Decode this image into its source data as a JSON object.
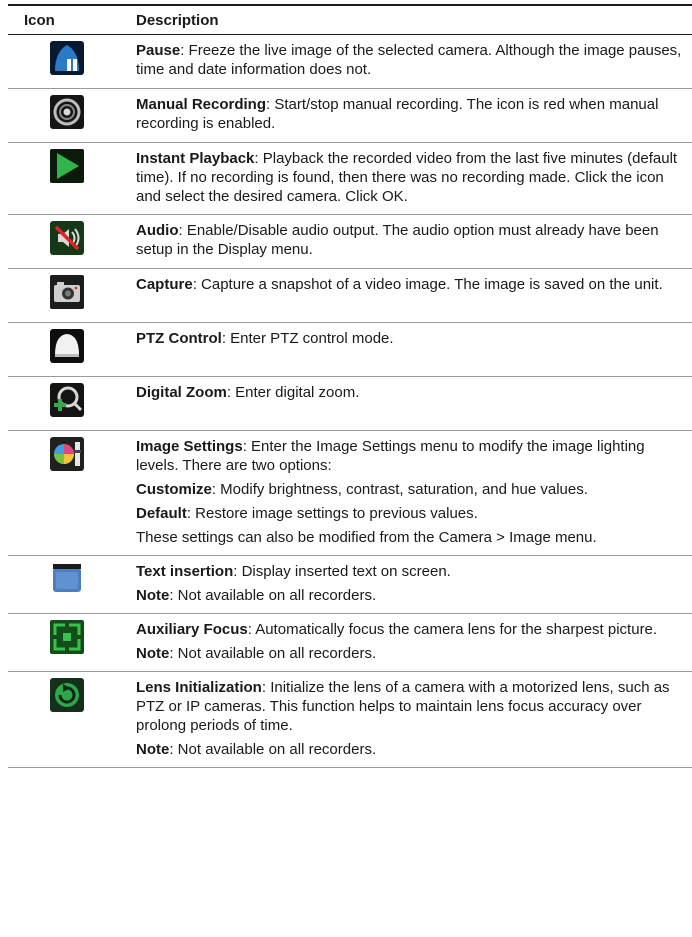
{
  "header": {
    "col_icon": "Icon",
    "col_desc": "Description"
  },
  "rows": [
    {
      "icon": "pause-icon",
      "paras": [
        {
          "term": "Pause",
          "text": ": Freeze the live image of the selected camera. Although the image pauses, time and date information does not."
        }
      ]
    },
    {
      "icon": "manual-record-icon",
      "paras": [
        {
          "term": "Manual Recording",
          "text": ": Start/stop manual recording. The icon is red when manual recording is enabled."
        }
      ]
    },
    {
      "icon": "instant-playback-icon",
      "paras": [
        {
          "term": "Instant Playback",
          "text": ": Playback the recorded video from the last five minutes (default time). If no recording is found, then there was no recording made. Click the icon and select the desired camera. Click OK."
        }
      ]
    },
    {
      "icon": "audio-mute-icon",
      "paras": [
        {
          "term": "Audio",
          "text": ": Enable/Disable audio output. The audio option must already have been setup in the Display menu."
        }
      ]
    },
    {
      "icon": "capture-camera-icon",
      "paras": [
        {
          "term": "Capture",
          "text": ": Capture a snapshot of a video image. The image is saved on the unit."
        }
      ]
    },
    {
      "icon": "ptz-dome-icon",
      "paras": [
        {
          "term": "PTZ Control",
          "text": ": Enter PTZ control mode."
        }
      ]
    },
    {
      "icon": "digital-zoom-icon",
      "paras": [
        {
          "term": "Digital Zoom",
          "text": ": Enter digital zoom."
        }
      ]
    },
    {
      "icon": "image-settings-icon",
      "paras": [
        {
          "term": "Image Settings",
          "text": ": Enter the Image Settings menu to modify the image lighting levels. There are two options:"
        },
        {
          "term": "Customize",
          "text": ": Modify brightness, contrast, saturation, and hue values."
        },
        {
          "term": "Default",
          "text": ": Restore image settings to previous values."
        },
        {
          "term": "",
          "text": "These settings can also be modified from the Camera > Image menu."
        }
      ]
    },
    {
      "icon": "text-insertion-icon",
      "paras": [
        {
          "term": "Text insertion",
          "text": ": Display inserted text on screen."
        },
        {
          "term": "Note",
          "text": ": Not available on all recorders."
        }
      ]
    },
    {
      "icon": "auxiliary-focus-icon",
      "paras": [
        {
          "term": "Auxiliary Focus",
          "text": ": Automatically focus the camera lens for the sharpest picture."
        },
        {
          "term": "Note",
          "text": ": Not available on all recorders."
        }
      ]
    },
    {
      "icon": "lens-initialization-icon",
      "paras": [
        {
          "term": "Lens Initialization",
          "text": ": Initialize the lens of a camera with a motorized lens, such as PTZ or IP cameras. This function helps to maintain lens focus accuracy over prolong periods of time."
        },
        {
          "term": "Note",
          "text": ": Not available on all recorders."
        }
      ]
    }
  ]
}
